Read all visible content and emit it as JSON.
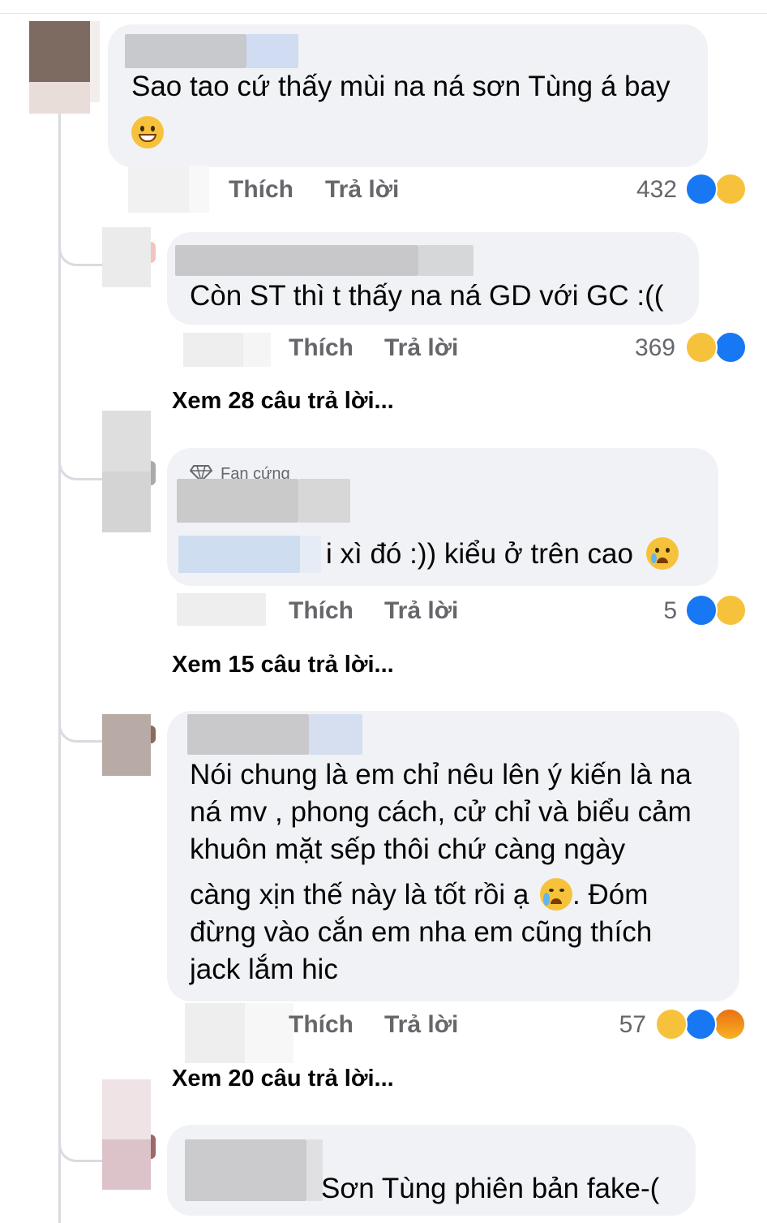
{
  "comments": [
    {
      "text": "Sao tao cứ thấy mùi na ná sơn Tùng á bay",
      "emoji_icon": "grinning-face-icon",
      "like_label": "Thích",
      "reply_label": "Trả lời",
      "reaction_count": "432",
      "reactions": [
        "like",
        "haha"
      ]
    },
    {
      "text": "Còn ST thì t thấy na ná GD với GC :((",
      "like_label": "Thích",
      "reply_label": "Trả lời",
      "reaction_count": "369",
      "reactions": [
        "haha",
        "like"
      ],
      "view_more": "Xem 28 câu trả lời..."
    },
    {
      "badge": "Fan cứng",
      "text": "i xì đó :)) kiểu ở trên cao",
      "emoji_icon": "sad-but-relieved-face-icon",
      "like_label": "Thích",
      "reply_label": "Trả lời",
      "reaction_count": "5",
      "reactions": [
        "like",
        "haha"
      ],
      "view_more": "Xem 15 câu trả lời..."
    },
    {
      "text_line1": "Nói chung là em chỉ nêu lên ý kiến là na",
      "text_line2": "ná mv , phong cách, cử chỉ và biểu cảm",
      "text_line3": "khuôn mặt sếp thôi chứ càng ngày",
      "text_line4a": "càng xịn thế này là tốt rồi ạ",
      "text_line4b": ". Đóm",
      "text_line5": "đừng vào cắn em nha em cũng thích",
      "text_line6": "jack lắm hic",
      "emoji_icon": "crying-face-icon",
      "like_label": "Thích",
      "reply_label": "Trả lời",
      "reaction_count": "57",
      "reactions": [
        "haha",
        "like",
        "angry"
      ],
      "view_more": "Xem 20 câu trả lời..."
    },
    {
      "text": "Sơn Tùng phiên bản fake-("
    }
  ],
  "colors": {
    "bubble": "#f0f2f5",
    "action_text": "#65676b",
    "like_blue": "#1877f2",
    "emoji_yellow": "#f7c23b"
  }
}
